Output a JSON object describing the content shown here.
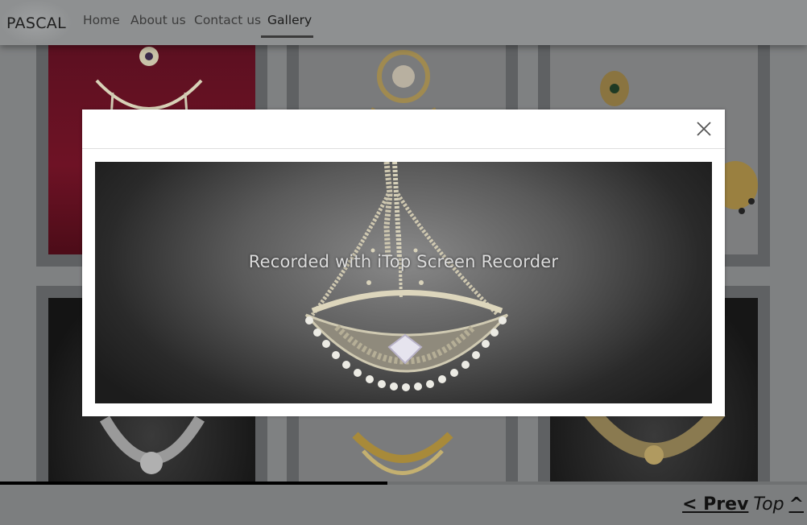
{
  "nav": {
    "brand": "PASCAL",
    "links": [
      {
        "label": "Home"
      },
      {
        "label": "About us"
      },
      {
        "label": "Contact us"
      },
      {
        "label": "Gallery",
        "active": true
      }
    ]
  },
  "gallery": {
    "items": [
      {
        "name": "maroon-background-passa-earring"
      },
      {
        "name": "kundan-maang-tikka"
      },
      {
        "name": "green-stone-maang-tikka"
      },
      {
        "name": "silver-diamond-necklace"
      },
      {
        "name": "gold-pearl-choker"
      },
      {
        "name": "antique-gold-necklace"
      }
    ]
  },
  "modal": {
    "close_icon": "close-icon",
    "watermark": "Recorded with iTop Screen Recorder"
  },
  "slideshow": {
    "progress": 0.48
  },
  "pager": {
    "prev_label": "< Prev",
    "top_label": "Top",
    "up_label": "^"
  },
  "colors": {
    "overlay": "#7f8182",
    "modal_bg": "#ffffff",
    "progress": "#000000"
  }
}
